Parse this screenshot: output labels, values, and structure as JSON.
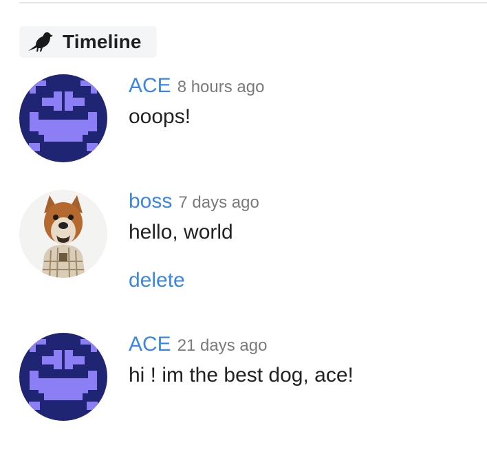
{
  "timeline": {
    "title": "Timeline",
    "icon": "crow-icon"
  },
  "colors": {
    "link": "#3a86e6",
    "meta": "#7a7a7a",
    "avatar_ace_bg": "#1f2473",
    "avatar_ace_fg": "#8c7ef5"
  },
  "posts": [
    {
      "author": "ACE",
      "time": "8 hours ago",
      "message": "ooops!",
      "avatar": "space-invader-avatar"
    },
    {
      "author": "boss",
      "time": "7 days ago",
      "message": "hello, world",
      "avatar": "dog-avatar",
      "action": "delete"
    },
    {
      "author": "ACE",
      "time": "21 days ago",
      "message": "hi ! im the best dog, ace!",
      "avatar": "space-invader-avatar"
    }
  ]
}
